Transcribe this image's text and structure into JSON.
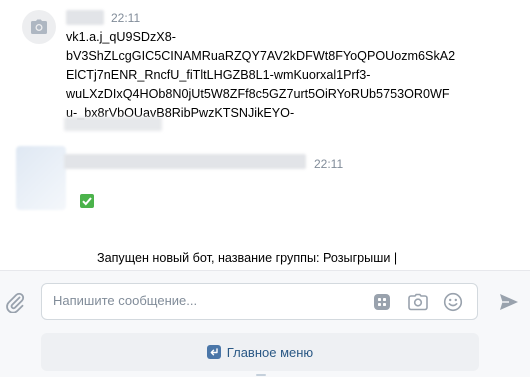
{
  "messages": [
    {
      "time": "22:11",
      "text": "vk1.a.j_qU9SDzX8-\nbV3ShZLcgGIC5CINAMRuaRZQY7AV2kDFWt8FYoQPOUozm6SkA2\nElCTj7nENR_RncfU_fiTltLHGZB8L1-wmKuorxal1Prf3-\nwuLXzDIxQ4HOb8N0jUt5W8ZFf8c5GZ7urt5OiRYoRUb5753OR0WF\nu-_bx8rVbOUavB8RibPwzKTSNJikEYO-"
    },
    {
      "time": "22:11",
      "emoji": "✅",
      "text": "Запущен новый бот, название группы: Розыгрыши |\nПРАНК БОТ"
    }
  ],
  "composer": {
    "placeholder": "Напишите сообщение...",
    "value": ""
  },
  "keyboard": {
    "main_menu_label": "Главное меню"
  },
  "colors": {
    "accent": "#4a76a8",
    "link": "#2a5885",
    "muted": "#818c99",
    "icon": "#99a2ad",
    "check_green": "#4bb34b"
  },
  "icons": [
    "camera-icon",
    "paperclip-icon",
    "bot-keyboard-icon",
    "camera-icon",
    "smile-icon",
    "send-icon",
    "return-icon",
    "check-mark-icon"
  ]
}
